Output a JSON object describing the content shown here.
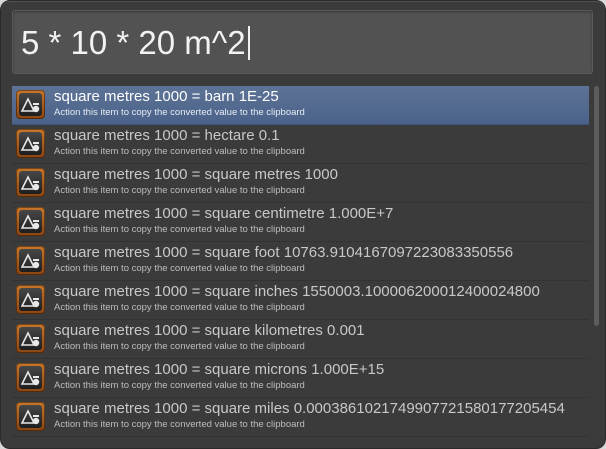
{
  "query": {
    "text": "5 * 10 * 20 m^2"
  },
  "results": [
    {
      "title": "square metres 1000 = barn 1E-25",
      "subtitle": "Action this item to copy the converted value to the clipboard",
      "icon": "scales-icon"
    },
    {
      "title": "square metres 1000 = hectare 0.1",
      "subtitle": "Action this item to copy the converted value to the clipboard",
      "icon": "scales-icon"
    },
    {
      "title": "square metres 1000 = square metres 1000",
      "subtitle": "Action this item to copy the converted value to the clipboard",
      "icon": "scales-icon"
    },
    {
      "title": "square metres 1000 = square centimetre 1.000E+7",
      "subtitle": "Action this item to copy the converted value to the clipboard",
      "icon": "scales-icon"
    },
    {
      "title": "square metres 1000 = square foot 10763.9104167097223083350556",
      "subtitle": "Action this item to copy the converted value to the clipboard",
      "icon": "scales-icon"
    },
    {
      "title": "square metres 1000 = square inches 1550003.10000620001240002480​0",
      "subtitle": "Action this item to copy the converted value to the clipboard",
      "icon": "scales-icon"
    },
    {
      "title": "square metres 1000 = square kilometres 0.001",
      "subtitle": "Action this item to copy the converted value to the clipboard",
      "icon": "scales-icon"
    },
    {
      "title": "square metres 1000 = square microns 1.000E+15",
      "subtitle": "Action this item to copy the converted value to the clipboard",
      "icon": "scales-icon"
    },
    {
      "title": "square metres 1000 = square miles 0.0003861021749907721580177205454",
      "subtitle": "Action this item to copy the converted value to the clipboard",
      "icon": "scales-icon"
    }
  ],
  "colors": {
    "window": "#3b3b3b",
    "selection": "#4f668d",
    "icon_frame": "#b5651d"
  }
}
